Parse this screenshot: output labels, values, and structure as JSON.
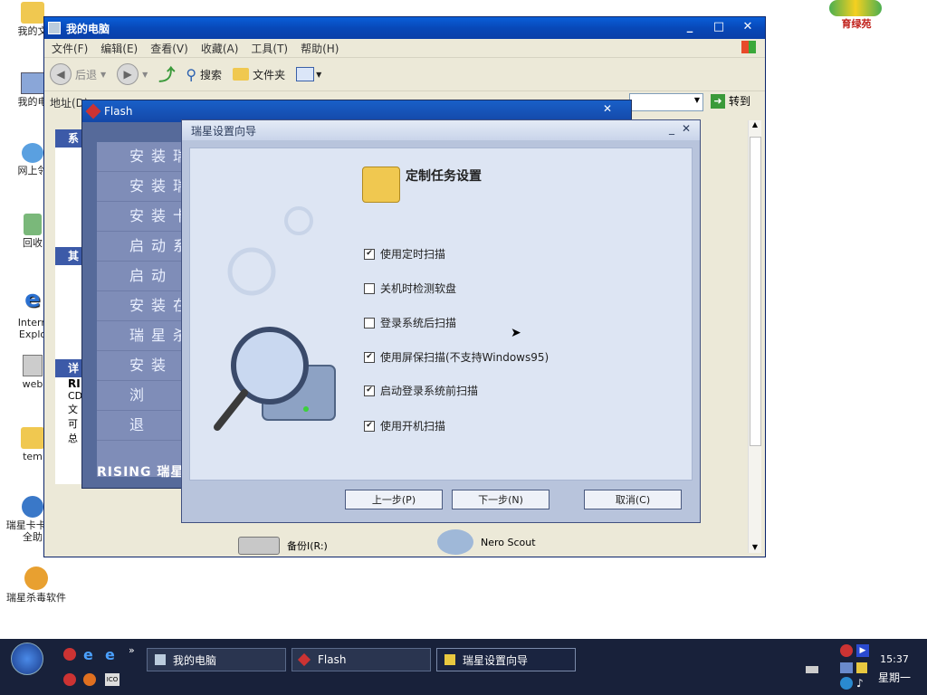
{
  "desktop": {
    "icons": [
      {
        "label": "我的文"
      },
      {
        "label": "我的电"
      },
      {
        "label": "网上邻"
      },
      {
        "label": "回收"
      },
      {
        "label": "Intern Explo"
      },
      {
        "label": "web"
      },
      {
        "label": "tem"
      },
      {
        "label": "瑞星卡卡 安全助"
      },
      {
        "label": "瑞星杀毒软件"
      }
    ],
    "logo_text": "育绿苑"
  },
  "mycomputer": {
    "title": "我的电脑",
    "menu": [
      "文件(F)",
      "编辑(E)",
      "查看(V)",
      "收藏(A)",
      "工具(T)",
      "帮助(H)"
    ],
    "toolbar": {
      "back": "后退",
      "search": "搜索",
      "folders": "文件夹"
    },
    "address_label": "地址(D)",
    "go_label": "转到",
    "left_panel": {
      "sys_header": "系",
      "other_header": "其",
      "detail_header": "详",
      "detail_lines": [
        "RI",
        "CD",
        "文",
        "可",
        "总"
      ]
    },
    "items": [
      {
        "label": "备份I(R:)"
      },
      {
        "label": "Nero Scout"
      }
    ]
  },
  "flash": {
    "title": "Flash",
    "menu": [
      "安装瑞",
      "安装瑞",
      "安装卡",
      "启动系",
      "启动",
      "安装在",
      "瑞星杀",
      "安装",
      "浏",
      "退"
    ],
    "logo": "RISING 瑞星"
  },
  "wizard": {
    "title": "瑞星设置向导",
    "heading": "定制任务设置",
    "options": [
      {
        "label": "使用定时扫描",
        "checked": true
      },
      {
        "label": "关机时检测软盘",
        "checked": false
      },
      {
        "label": "登录系统后扫描",
        "checked": false
      },
      {
        "label": "使用屏保扫描(不支持Windows95)",
        "checked": true
      },
      {
        "label": "启动登录系统前扫描",
        "checked": true
      },
      {
        "label": "使用开机扫描",
        "checked": true
      }
    ],
    "buttons": {
      "prev": "上一步(P)",
      "next": "下一步(N)",
      "cancel": "取消(C)"
    }
  },
  "taskbar": {
    "tasks": [
      {
        "label": "我的电脑"
      },
      {
        "label": "Flash"
      },
      {
        "label": "瑞星设置向导"
      }
    ],
    "time": "15:37",
    "day": "星期一"
  }
}
